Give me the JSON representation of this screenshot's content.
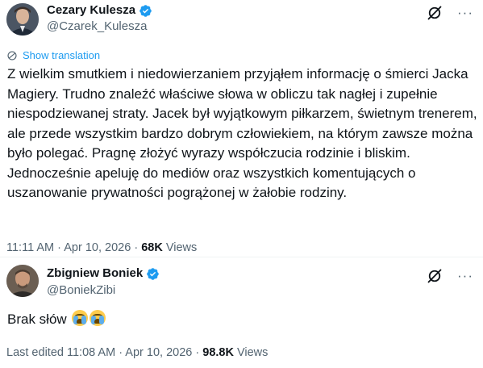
{
  "tweet1": {
    "name": "Cezary Kulesza",
    "handle": "@Czarek_Kulesza",
    "show_translation": "Show translation",
    "text": "Z wielkim smutkiem i niedowierzaniem przyjąłem informację o śmierci Jacka Magiery. Trudno znaleźć właściwe słowa w obliczu tak nagłej i zupełnie niespodziewanej straty. Jacek był wyjątkowym piłkarzem, świetnym trenerem, ale przede wszystkim bardzo dobrym człowiekiem, na którym zawsze można było polegać. Pragnę złożyć wyrazy współczucia rodzinie i bliskim. Jednocześnie apeluję do mediów oraz wszystkich komentujących o uszanowanie prywatności pogrążonej w żałobie rodziny.",
    "time": "11:11 AM",
    "date": "Apr 10, 2026",
    "views_count": "68K",
    "views_label": "Views"
  },
  "tweet2": {
    "name": "Zbigniew Boniek",
    "handle": "@BoniekZibi",
    "text": "Brak słów",
    "edited_label": "Last edited",
    "time": "11:08 AM",
    "date": "Apr 10, 2026",
    "views_count": "98.8K",
    "views_label": "Views"
  },
  "separator": "·",
  "more_glyph": "···",
  "icons": [
    "verified-badge-icon",
    "grok-icon",
    "more-icon",
    "translate-globe-icon",
    "loudly-crying-face-emoji"
  ],
  "colors": {
    "accent": "#1d9bf0",
    "secondary_text": "#536471",
    "primary_text": "#0f1419"
  }
}
